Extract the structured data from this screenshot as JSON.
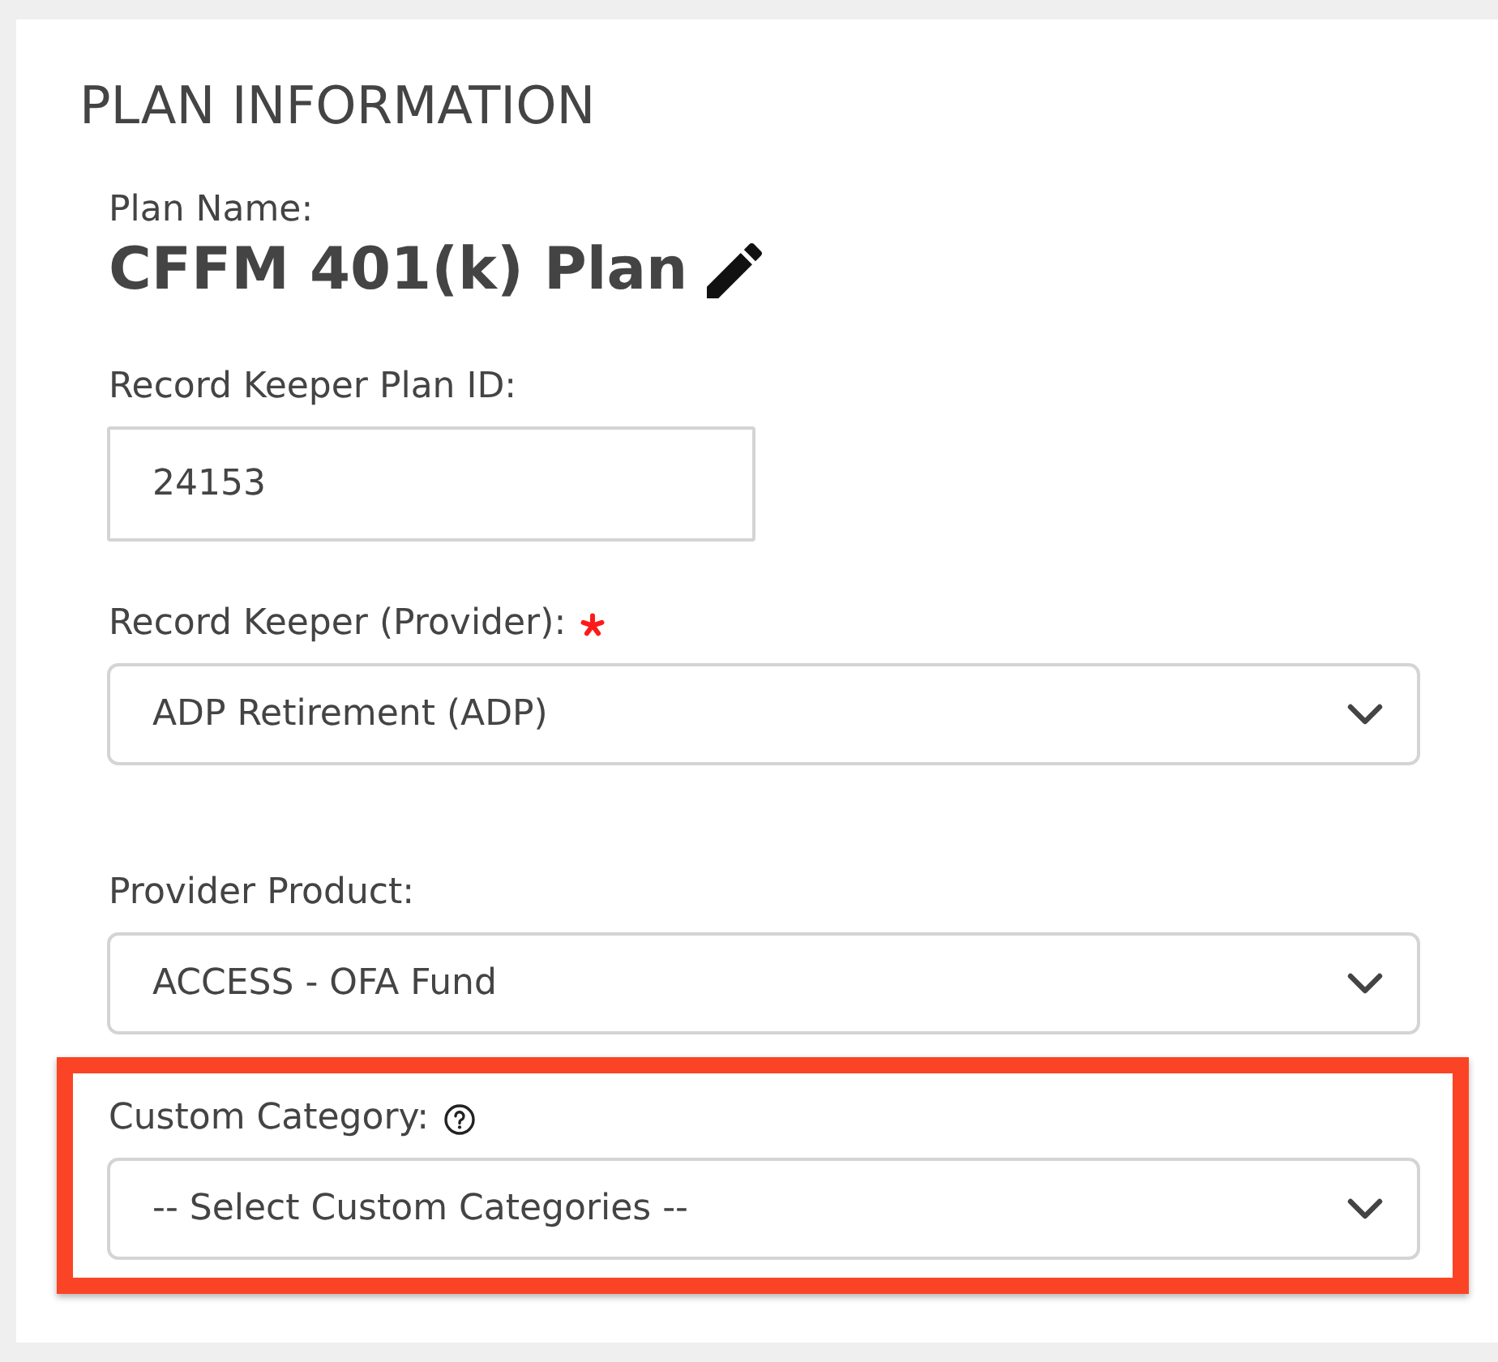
{
  "panel": {
    "title": "PLAN INFORMATION"
  },
  "plan_name": {
    "label": "Plan Name:",
    "value": "CFFM 401(k) Plan",
    "editable": true
  },
  "fields": [
    {
      "kind": "text",
      "label": "Record Keeper Plan ID:",
      "value": "24153",
      "required": false,
      "help": false,
      "highlighted": false
    },
    {
      "kind": "select",
      "label": "Record Keeper (Provider):",
      "value": "ADP Retirement (ADP)",
      "required": true,
      "help": false,
      "highlighted": false
    },
    {
      "kind": "select",
      "label": "Provider Product:",
      "value": "ACCESS - OFA Fund",
      "required": false,
      "help": false,
      "highlighted": false
    },
    {
      "kind": "select",
      "label": "Custom Category:",
      "value": "-- Select Custom Categories --",
      "required": false,
      "help": true,
      "highlighted": true
    }
  ]
}
